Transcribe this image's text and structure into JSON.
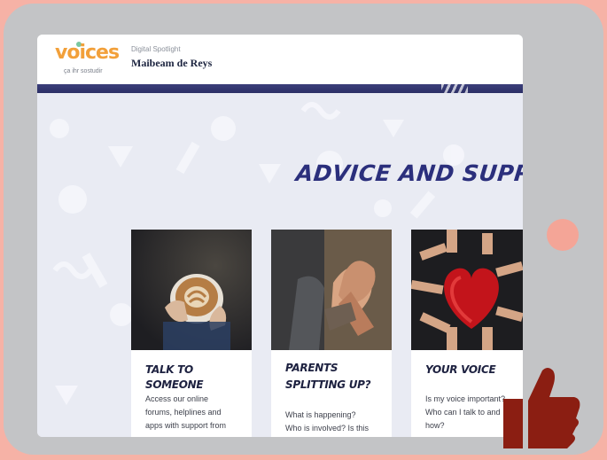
{
  "colors": {
    "background": "#f6b2a6",
    "tablet": "#c3c4c6",
    "heading": "#2b2f7c",
    "logo": "#f2a03a",
    "thumb": "#8b1e12"
  },
  "site": {
    "logo_text": "voices",
    "logo_sub": "ça ihr sostudir",
    "subtitle": "Digital Spotlight",
    "title": "Maibeam de Reys"
  },
  "page": {
    "heading": "ADVICE AND SUPPORT"
  },
  "cards": [
    {
      "title": "TALK TO SOMEONE",
      "text_lines": [
        "Access our online",
        "forums, helplines and",
        "apps with support from"
      ],
      "image": "latte-cup-photo"
    },
    {
      "title_lines": [
        "PARENTS",
        "SPLITTING UP?"
      ],
      "text_lines": [
        "What is happening?",
        "Who is involved? Is this"
      ],
      "image": "holding-hands-photo"
    },
    {
      "title": "YOUR VOICE",
      "text_lines": [
        "Is my voice important?",
        "Who can I talk to and",
        "how?"
      ],
      "image": "hands-red-heart-photo"
    }
  ],
  "icons": {
    "thumb": "thumbs-up-icon",
    "camera": "tablet-camera-dot"
  }
}
